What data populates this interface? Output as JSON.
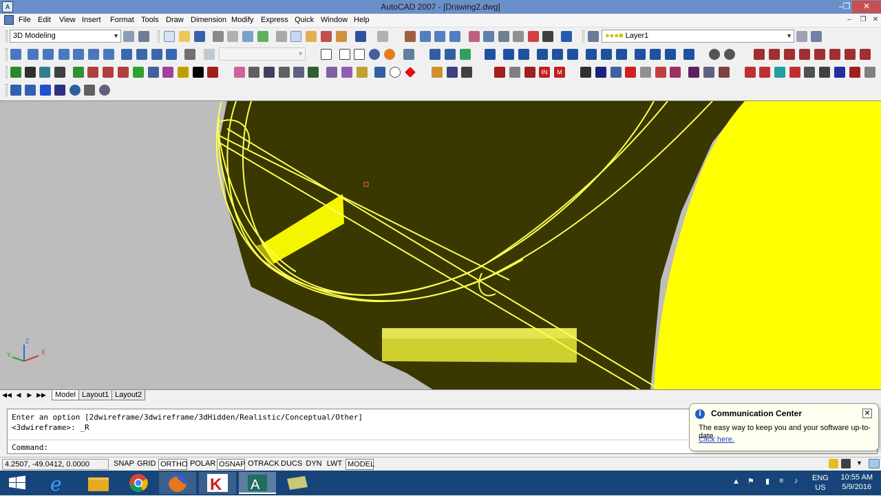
{
  "window": {
    "title": "AutoCAD 2007 - [Drawing2.dwg]",
    "app_icon_text": "A"
  },
  "menu": [
    "File",
    "Edit",
    "View",
    "Insert",
    "Format",
    "Tools",
    "Draw",
    "Dimension",
    "Modify",
    "Express",
    "Quick",
    "Window",
    "Help"
  ],
  "toolbar": {
    "workspace": "3D Modeling",
    "layer": "Layer1"
  },
  "tabs": [
    "Model",
    "Layout1",
    "Layout2"
  ],
  "command": {
    "line1": "Enter an option [2dwireframe/3dwireframe/3dHidden/Realistic/Conceptual/Other]",
    "line2": "<3dwireframe>: _R",
    "prompt": "Command:"
  },
  "status": {
    "coords": "4.2507, -49.0412, 0.0000",
    "buttons": [
      "SNAP",
      "GRID",
      "ORTHO",
      "POLAR",
      "OSNAP",
      "OTRACK",
      "DUCS",
      "DYN",
      "LWT",
      "MODEL"
    ],
    "active": [
      "ORTHO",
      "OSNAP",
      "MODEL"
    ]
  },
  "comm_center": {
    "title": "Communication Center",
    "message": "The easy way to keep you and your software up-to-date.",
    "link": "Click here."
  },
  "taskbar": {
    "lang1": "ENG",
    "lang2": "US",
    "time": "10:55 AM",
    "date": "5/9/2016"
  },
  "ucs": {
    "x": "X",
    "y": "Y",
    "z": "Z"
  },
  "colors": {
    "viewport_bg": "#bdbdbd",
    "model_dark": "#393800",
    "wire": "#ffff00",
    "taskbar": "#17457a"
  }
}
